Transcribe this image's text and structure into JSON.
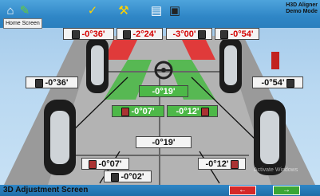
{
  "header": {
    "home_label": "Home Screen",
    "brand_line1": "H3D Aligner",
    "brand_line2": "Demo Mode",
    "icons": [
      "home-icon",
      "vehicle-specs-icon",
      "checkmark-icon",
      "tools-icon",
      "report-icon",
      "camera-icon"
    ]
  },
  "front_axle": {
    "left_camber": "-0°36'",
    "left_caster": "-2°24'",
    "right_caster": "-3°00'",
    "right_camber": "-0°54'",
    "left_sai": "-0°36'",
    "right_sai": "-0°54'",
    "total_toe": "-0°19'",
    "left_toe": "-0°07'",
    "right_toe": "-0°12'"
  },
  "rear_axle": {
    "total_toe": "-0°19'",
    "left_toe": "-0°07'",
    "right_toe": "-0°12'",
    "thrust_angle": "-0°02'"
  },
  "footer": {
    "screen_title": "3D Adjustment Screen",
    "watermark": "Activate Windows"
  },
  "colors": {
    "accent_blue": "#2f86c6",
    "out_of_spec": "#d40000",
    "in_spec": "#4db848"
  }
}
